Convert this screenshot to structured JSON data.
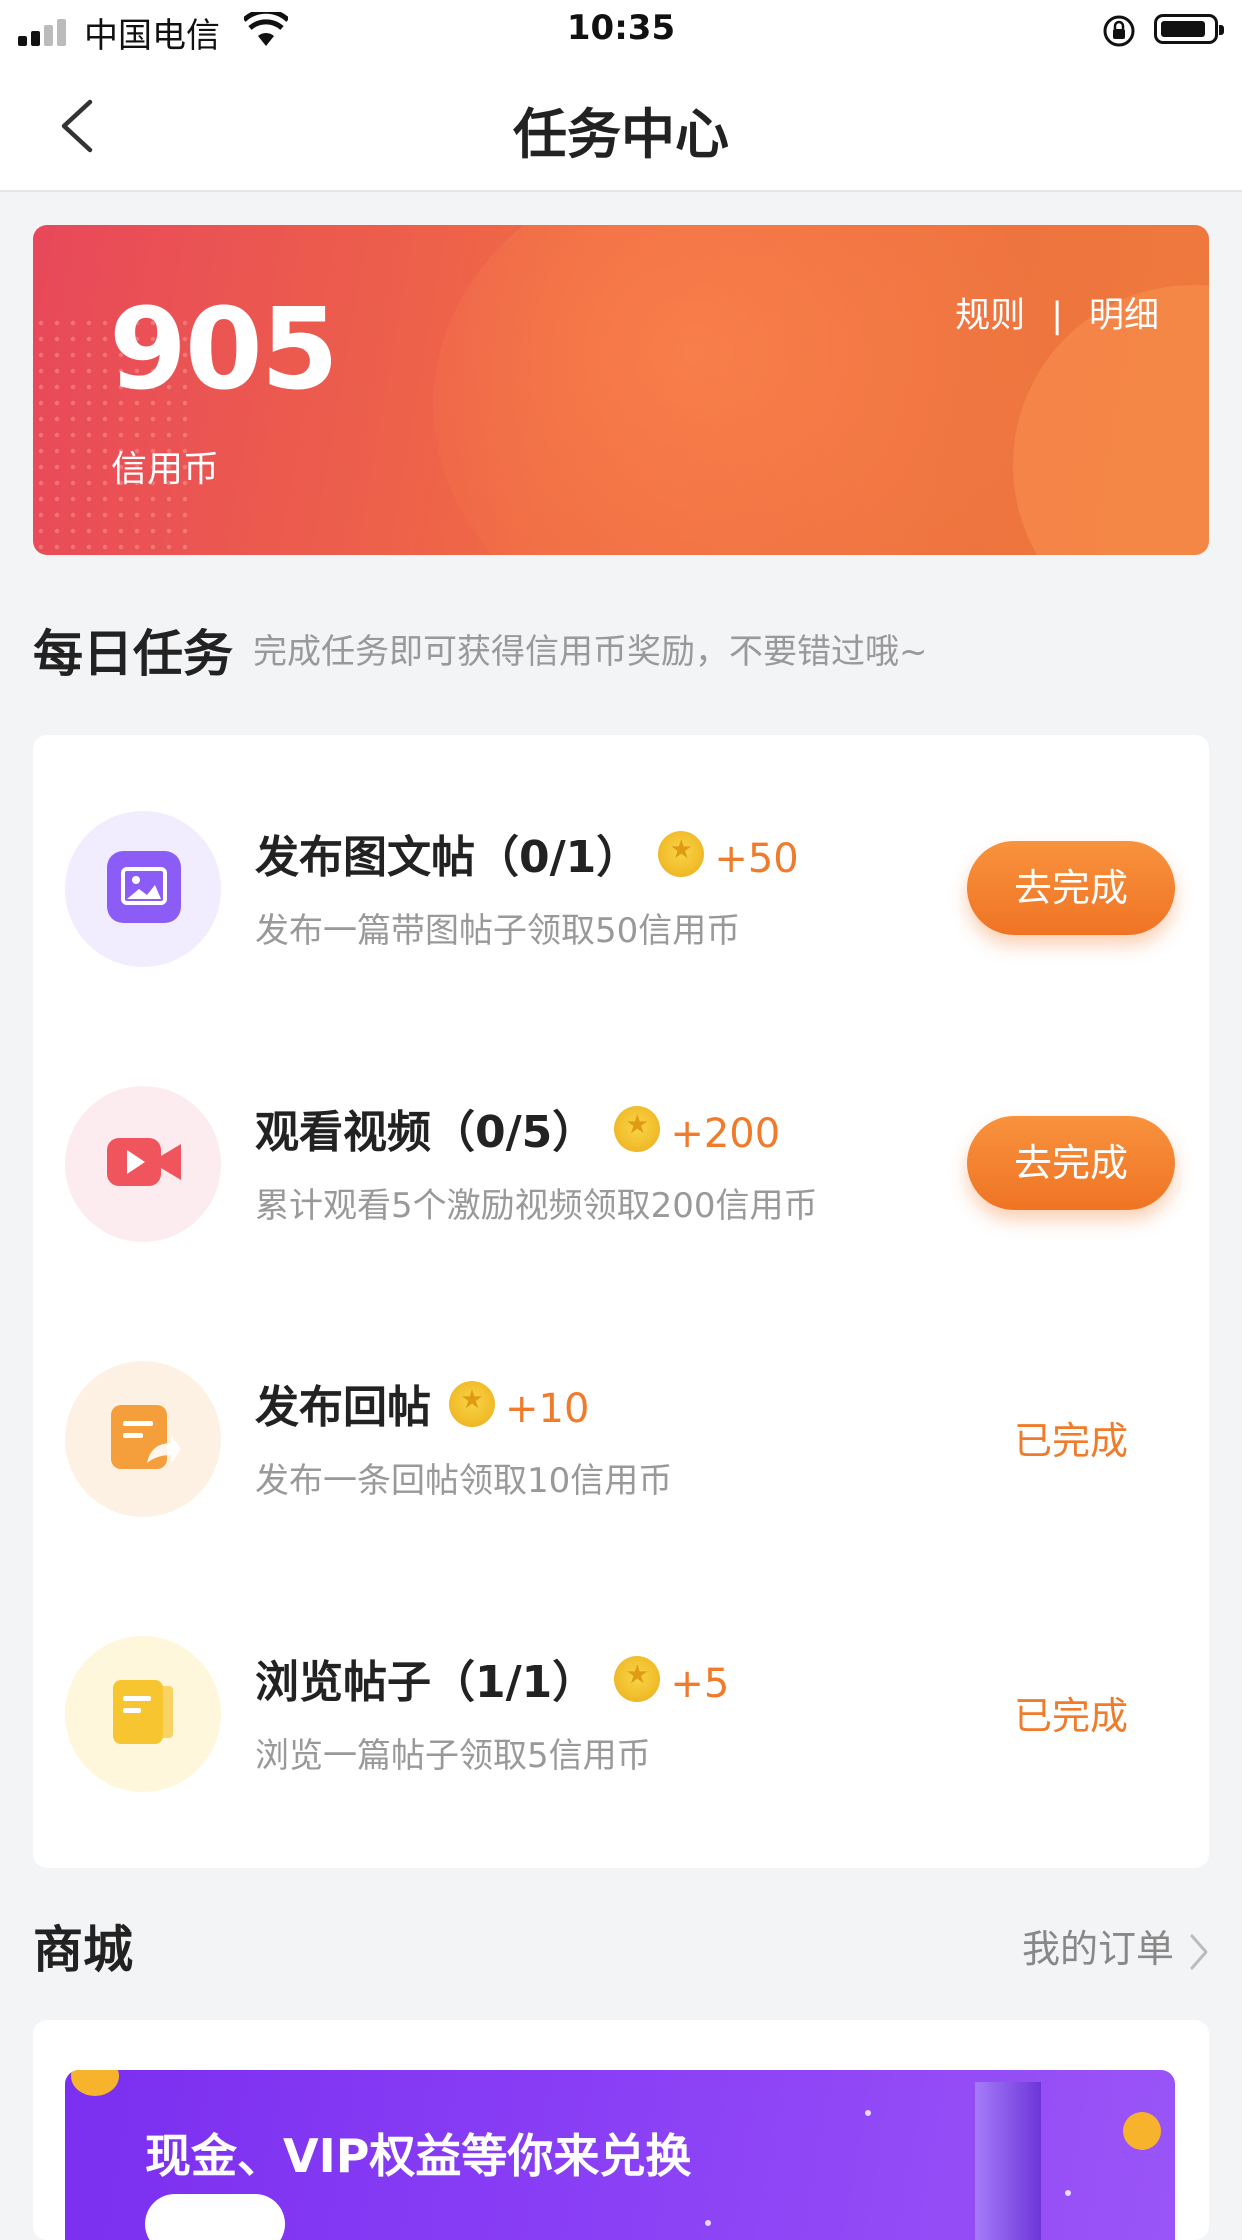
{
  "status_bar": {
    "carrier": "中国电信",
    "time": "10:35"
  },
  "nav": {
    "title": "任务中心"
  },
  "credit": {
    "balance": "905",
    "label": "信用币",
    "rules_link": "规则",
    "separator": "|",
    "details_link": "明细"
  },
  "daily": {
    "title": "每日任务",
    "subtitle": "完成任务即可获得信用币奖励，不要错过哦~",
    "tasks": [
      {
        "name": "发布图文帖（0/1）",
        "reward": "+50",
        "desc": "发布一篇带图帖子领取50信用币",
        "action": "去完成",
        "icon": "image-post-icon",
        "color": "#8b5cf6"
      },
      {
        "name": "观看视频（0/5）",
        "reward": "+200",
        "desc": "累计观看5个激励视频领取200信用币",
        "action": "去完成",
        "icon": "video-camera-icon",
        "color": "#f0545c"
      },
      {
        "name": "发布回帖",
        "reward": "+10",
        "desc": "发布一条回帖领取10信用币",
        "action": "已完成",
        "icon": "reply-post-icon",
        "color": "#f59e3c"
      },
      {
        "name": "浏览帖子（1/1）",
        "reward": "+5",
        "desc": "浏览一篇帖子领取5信用币",
        "action": "已完成",
        "icon": "browse-post-icon",
        "color": "#f7c530"
      }
    ]
  },
  "mall": {
    "title": "商城",
    "orders_link": "我的订单",
    "banner_text": "现金、VIP权益等你来兑换"
  },
  "colors": {
    "accent": "#f07b2b",
    "banner_start": "#e8485a",
    "banner_end": "#ee7a3c",
    "mall_purple": "#7b2ff0"
  }
}
